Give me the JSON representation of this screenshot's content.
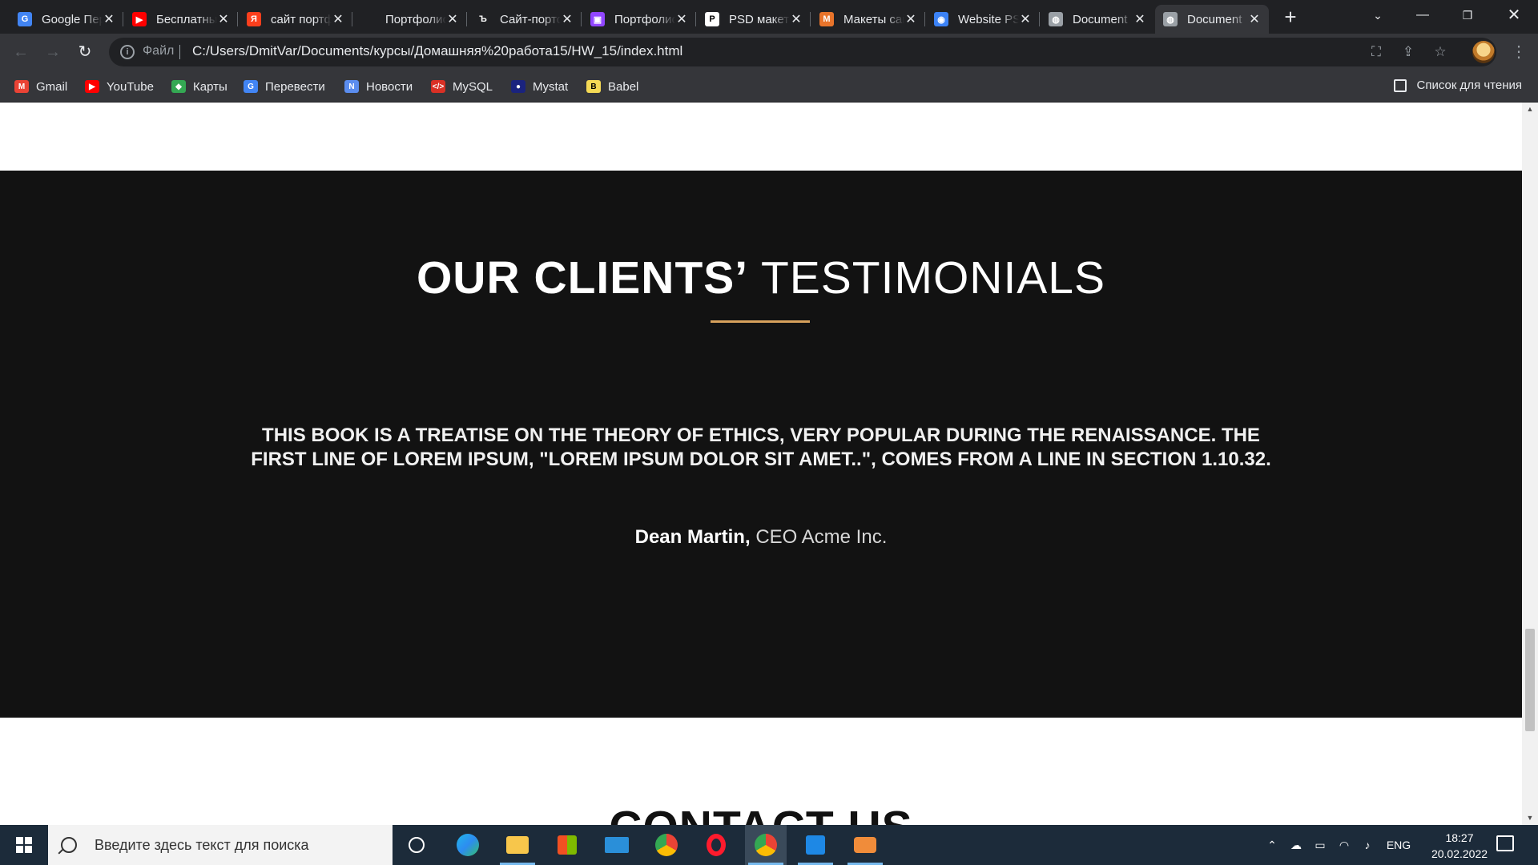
{
  "browser": {
    "tabs": [
      {
        "title": "Google Переводчик",
        "icon": "google-translate-icon",
        "color": "#4285f4",
        "glyph": "G"
      },
      {
        "title": "Бесплатные",
        "icon": "youtube-icon",
        "color": "#ff0000",
        "glyph": "▶"
      },
      {
        "title": "сайт портфолио",
        "icon": "yandex-icon",
        "color": "#fc3f1d",
        "glyph": "Я"
      },
      {
        "title": "Портфолио",
        "icon": "blank-page-icon",
        "color": "#202124",
        "glyph": ""
      },
      {
        "title": "Сайт-портфолио",
        "icon": "tilda-icon",
        "color": "#202124",
        "glyph": "Ъ"
      },
      {
        "title": "Портфолио",
        "icon": "twitch-icon",
        "color": "#9146ff",
        "glyph": "▣"
      },
      {
        "title": "PSD макеты",
        "icon": "psd-icon",
        "color": "#ffffff",
        "glyph": "P"
      },
      {
        "title": "Макеты сайтов",
        "icon": "market-icon",
        "color": "#e8742b",
        "glyph": "M"
      },
      {
        "title": "Website PSD",
        "icon": "robot-icon",
        "color": "#3b82f6",
        "glyph": "◉"
      },
      {
        "title": "Document",
        "icon": "globe-icon",
        "color": "#9aa0a6",
        "glyph": "◍"
      },
      {
        "title": "Document",
        "icon": "globe-icon",
        "color": "#9aa0a6",
        "glyph": "◍"
      }
    ],
    "active_tab": 10,
    "address": {
      "scheme_label": "Файл",
      "url": "C:/Users/DmitVar/Documents/курсы/Домашняя%20работа15/HW_15/index.html"
    },
    "bookmarks": [
      {
        "label": "Gmail",
        "icon": "gmail-icon",
        "color": "#ea4335",
        "glyph": "M"
      },
      {
        "label": "YouTube",
        "icon": "youtube-icon",
        "color": "#ff0000",
        "glyph": "▶"
      },
      {
        "label": "Карты",
        "icon": "maps-icon",
        "color": "#34a853",
        "glyph": "◆"
      },
      {
        "label": "Перевести",
        "icon": "translate-icon",
        "color": "#4285f4",
        "glyph": "G"
      },
      {
        "label": "Новости",
        "icon": "news-icon",
        "color": "#5b8def",
        "glyph": "N"
      },
      {
        "label": "MySQL",
        "icon": "code-icon",
        "color": "#d93025",
        "glyph": "</>"
      },
      {
        "label": "Mystat",
        "icon": "mystat-icon",
        "color": "#1a237e",
        "glyph": "●"
      },
      {
        "label": "Babel",
        "icon": "babel-icon",
        "color": "#f5da55",
        "glyph": "B"
      }
    ],
    "reading_list": "Список для чтения"
  },
  "page": {
    "testimonials": {
      "title_bold": "OUR CLIENTS’",
      "title_light": "TESTIMONIALS",
      "quote": "THIS BOOK IS A TREATISE ON THE THEORY OF ETHICS, VERY POPULAR DURING THE RENAISSANCE. THE FIRST LINE OF LOREM IPSUM, \"LOREM IPSUM DOLOR SIT AMET..\", COMES FROM A LINE IN SECTION 1.10.32.",
      "author_name": "Dean Martin,",
      "author_role": "CEO Acme Inc."
    },
    "contact_title": "CONTACT US",
    "accent_color": "#d7a15c",
    "section_bg": "#121212"
  },
  "taskbar": {
    "search_placeholder": "Введите здесь текст для поиска",
    "apps": [
      "cortana-icon",
      "edge-icon",
      "file-explorer-icon",
      "store-icon",
      "mail-icon",
      "chrome-icon",
      "opera-icon",
      "chrome-icon",
      "vscode-icon",
      "app-icon"
    ],
    "language": "ENG",
    "time": "18:27",
    "date": "20.02.2022"
  }
}
